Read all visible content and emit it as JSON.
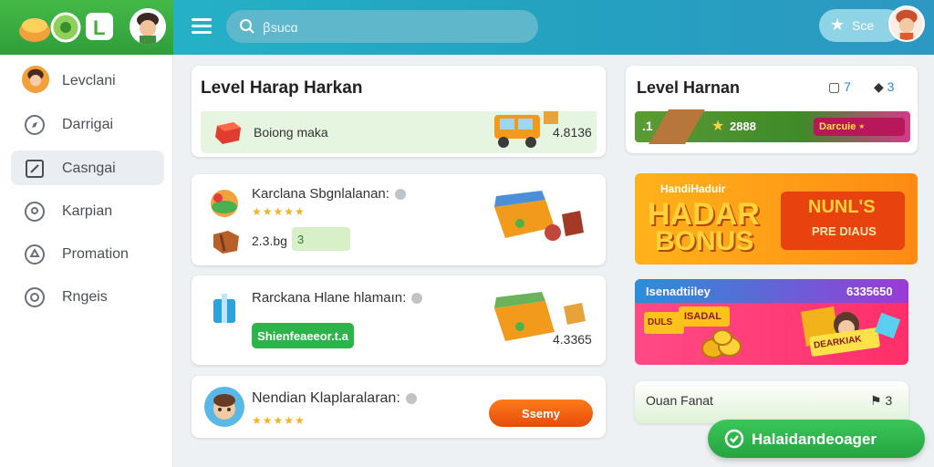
{
  "header": {
    "search_placeholder": "ꞵsucɑ",
    "star_label": "Sce"
  },
  "sidebar": {
    "items": [
      {
        "label": "Levclani",
        "icon": "avatar-icon",
        "active": false
      },
      {
        "label": "Darrigai",
        "icon": "compass-icon",
        "active": false
      },
      {
        "label": "Casngai",
        "icon": "edit-icon",
        "active": true
      },
      {
        "label": "Karpian",
        "icon": "location-icon",
        "active": false
      },
      {
        "label": "Promation",
        "icon": "tag-icon",
        "active": false
      },
      {
        "label": "Rngeis",
        "icon": "settings-icon",
        "active": false
      }
    ]
  },
  "main": {
    "card1": {
      "title": "Level Harap Harkan",
      "item_label": "Boiong maka",
      "value": "4.8136"
    },
    "card2": {
      "title": "Karclana Sbgnlalanan:",
      "price": "2.3.bg",
      "chip": "3"
    },
    "card3": {
      "title": "Rarckana Hlane hlamaın:",
      "button": "Shienfeaeeor.t.a",
      "value": "4.3365"
    },
    "card4": {
      "title": "Nendian Klaplaralaran:",
      "button": "Ssemy"
    }
  },
  "right": {
    "card1": {
      "title": "Level Harnan",
      "count_a": "7",
      "count_b": "3",
      "strip_left": ".1",
      "strip_value": "2888",
      "strip_badge": "Darcuie ⋆"
    },
    "bonus": {
      "tag": "HandiHaduir",
      "line1": "HADAR",
      "line2": "BONUS",
      "side1": "NUNL'S",
      "side2": "PRE DIAUS"
    },
    "promo": {
      "left": "Isenadtiiley",
      "right": "6335650",
      "chip1": "DULS",
      "chip2": "ISADAL",
      "chip3": "DEARKIAK"
    },
    "bottom": {
      "label": "Ouan Fanat",
      "count": "3"
    }
  },
  "fab": {
    "label": "Halaidandeoager"
  },
  "colors": {
    "topbar": "#27b7c9",
    "brand_green": "#44b947",
    "accent_green": "#2db34a",
    "accent_orange": "#ff7a1a",
    "star": "#f5b324"
  }
}
